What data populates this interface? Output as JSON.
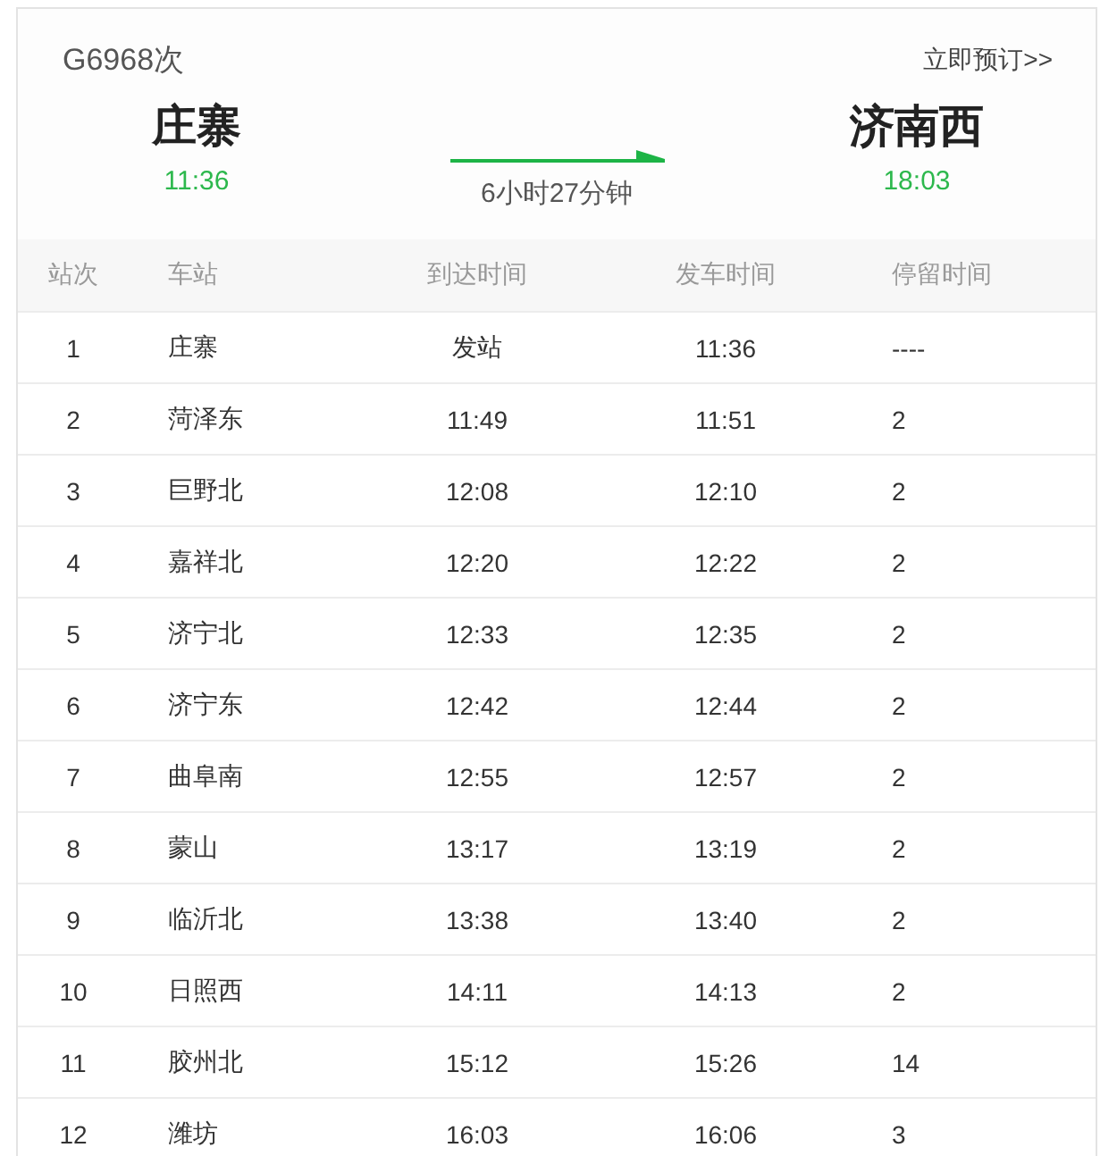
{
  "train": {
    "number": "G6968次",
    "book_link": "立即预订>>"
  },
  "route": {
    "from": {
      "station": "庄寨",
      "time": "11:36"
    },
    "duration": "6小时27分钟",
    "to": {
      "station": "济南西",
      "time": "18:03"
    }
  },
  "table": {
    "columns": [
      "站次",
      "车站",
      "到达时间",
      "发车时间",
      "停留时间"
    ],
    "rows": [
      [
        "1",
        "庄寨",
        "发站",
        "11:36",
        "----"
      ],
      [
        "2",
        "菏泽东",
        "11:49",
        "11:51",
        "2"
      ],
      [
        "3",
        "巨野北",
        "12:08",
        "12:10",
        "2"
      ],
      [
        "4",
        "嘉祥北",
        "12:20",
        "12:22",
        "2"
      ],
      [
        "5",
        "济宁北",
        "12:33",
        "12:35",
        "2"
      ],
      [
        "6",
        "济宁东",
        "12:42",
        "12:44",
        "2"
      ],
      [
        "7",
        "曲阜南",
        "12:55",
        "12:57",
        "2"
      ],
      [
        "8",
        "蒙山",
        "13:17",
        "13:19",
        "2"
      ],
      [
        "9",
        "临沂北",
        "13:38",
        "13:40",
        "2"
      ],
      [
        "10",
        "日照西",
        "14:11",
        "14:13",
        "2"
      ],
      [
        "11",
        "胶州北",
        "15:12",
        "15:26",
        "14"
      ],
      [
        "12",
        "潍坊",
        "16:03",
        "16:06",
        "3"
      ]
    ]
  }
}
